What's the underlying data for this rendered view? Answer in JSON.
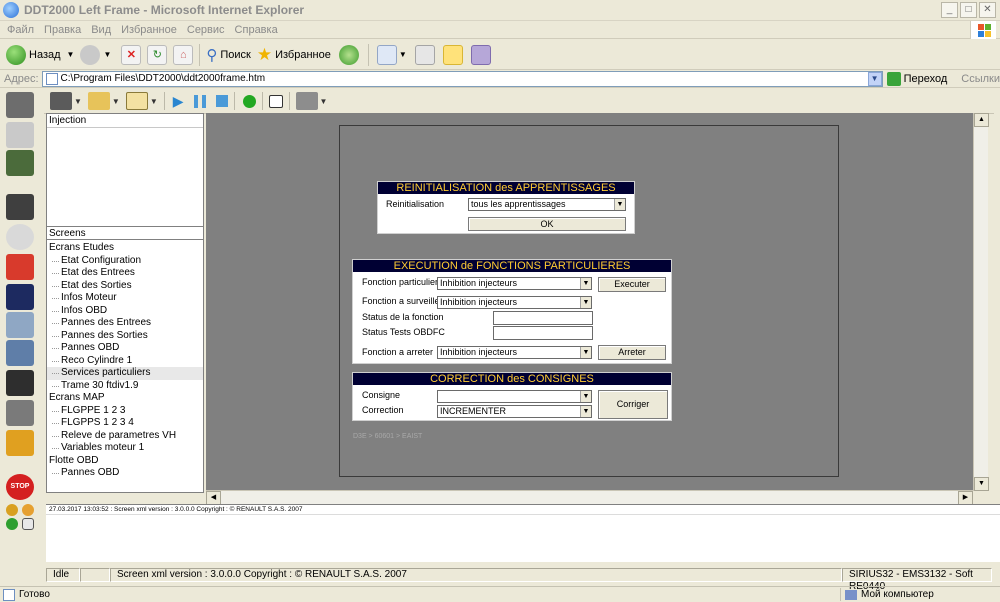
{
  "window": {
    "title": "DDT2000 Left Frame - Microsoft Internet Explorer"
  },
  "menu": [
    "Файл",
    "Правка",
    "Вид",
    "Избранное",
    "Сервис",
    "Справка"
  ],
  "toolbar": {
    "back": "Назад",
    "search": "Поиск",
    "favorites": "Избранное"
  },
  "address": {
    "label": "Адрес:",
    "url": "C:\\Program Files\\DDT2000\\ddt2000frame.htm",
    "go": "Переход",
    "links": "Ссылки"
  },
  "left_panel": {
    "top_title": "Injection",
    "screens_title": "Screens",
    "tree": [
      {
        "label": "Ecrans Etudes",
        "type": "node"
      },
      {
        "label": "Etat Configuration",
        "type": "leaf"
      },
      {
        "label": "Etat des Entrees",
        "type": "leaf"
      },
      {
        "label": "Etat des Sorties",
        "type": "leaf"
      },
      {
        "label": "Infos Moteur",
        "type": "leaf"
      },
      {
        "label": "Infos OBD",
        "type": "leaf"
      },
      {
        "label": "Pannes des Entrees",
        "type": "leaf"
      },
      {
        "label": "Pannes des Sorties",
        "type": "leaf"
      },
      {
        "label": "Pannes OBD",
        "type": "leaf"
      },
      {
        "label": "Reco Cylindre 1",
        "type": "leaf"
      },
      {
        "label": "Services particuliers",
        "type": "leaf",
        "selected": true
      },
      {
        "label": "Trame 30 ftdiv1.9",
        "type": "leaf"
      },
      {
        "label": "Ecrans MAP",
        "type": "node"
      },
      {
        "label": "FLGPPE 1 2 3",
        "type": "leaf"
      },
      {
        "label": "FLGPPS 1 2 3 4",
        "type": "leaf"
      },
      {
        "label": "Releve de parametres VH",
        "type": "leaf"
      },
      {
        "label": "Variables moteur 1",
        "type": "leaf"
      },
      {
        "label": "Flotte OBD",
        "type": "node"
      },
      {
        "label": "Pannes OBD",
        "type": "leaf"
      }
    ]
  },
  "reinit": {
    "title": "REINITIALISATION des APPRENTISSAGES",
    "label": "Reinitialisation",
    "value": "tous les apprentissages",
    "ok": "OK"
  },
  "execution": {
    "title": "EXECUTION de FONCTIONS PARTICULIERES",
    "f_label": "Fonction particuliere",
    "f_value": "Inhibition injecteurs",
    "execute": "Executer",
    "s_label": "Fonction a surveiller",
    "s_value": "Inhibition injecteurs",
    "status_label": "Status de la fonction",
    "status_tests_label": "Status Tests OBDFC",
    "a_label": "Fonction a arreter",
    "a_value": "Inhibition injecteurs",
    "stop": "Arreter"
  },
  "correction": {
    "title": "CORRECTION des CONSIGNES",
    "c_label": "Consigne",
    "c_value": "",
    "corr_label": "Correction",
    "corr_value": "INCREMENTER",
    "apply": "Corriger"
  },
  "footnote": "D3E > 60601 > EAIST",
  "log": {
    "line1": "27.03.2017 13:03:52 : Screen xml version : 3.0.0.0   Copyright : © RENAULT S.A.S. 2007"
  },
  "app_status": {
    "state": "Idle",
    "message": "Screen xml version : 3.0.0.0   Copyright : © RENAULT S.A.S. 2007",
    "ecu": "SIRIUS32 - EMS3132 - Soft RE0440"
  },
  "ie_status": {
    "left": "Готово",
    "zone": "Мой компьютер"
  }
}
